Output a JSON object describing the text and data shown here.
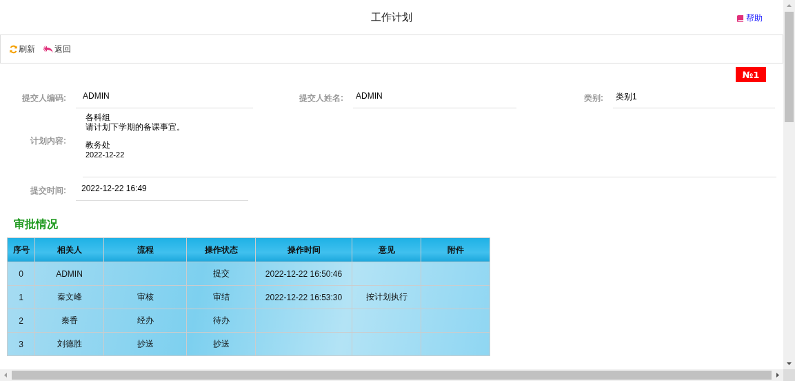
{
  "page": {
    "title": "工作计划",
    "help_link": "帮助"
  },
  "toolbar": [
    {
      "kind": "refresh",
      "label": "刷新"
    },
    {
      "kind": "back",
      "label": "返回"
    }
  ],
  "badge": "№1",
  "form": {
    "submitter_code": {
      "label": "提交人编码:",
      "value": "ADMIN"
    },
    "submitter_name": {
      "label": "提交人姓名:",
      "value": "ADMIN"
    },
    "category": {
      "label": "类别:",
      "value": "类别1"
    },
    "plan_content": {
      "label": "计划内容:",
      "lines": [
        "各科组",
        "请计划下学期的备课事宜。",
        "教务处",
        "2022-12-22"
      ]
    },
    "submit_time": {
      "label": "提交时间:",
      "value": "2022-12-22 16:49"
    }
  },
  "approval": {
    "title": "审批情况",
    "columns": [
      "序号",
      "相关人",
      "流程",
      "操作状态",
      "操作时间",
      "意见",
      "附件"
    ],
    "rows": [
      [
        "0",
        "ADMIN",
        "",
        "提交",
        "2022-12-22 16:50:46",
        "",
        ""
      ],
      [
        "1",
        "秦文峰",
        "审核",
        "审结",
        "2022-12-22 16:53:30",
        "按计划执行",
        ""
      ],
      [
        "2",
        "秦香",
        "经办",
        "待办",
        "",
        "",
        ""
      ],
      [
        "3",
        "刘德胜",
        "抄送",
        "抄送",
        "",
        "",
        ""
      ]
    ]
  }
}
